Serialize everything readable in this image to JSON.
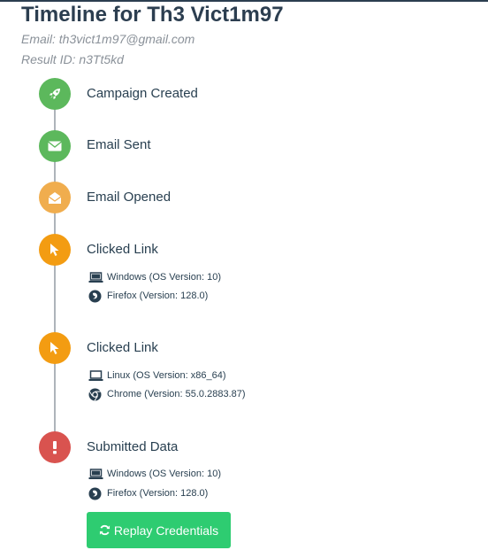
{
  "page": {
    "title": "Timeline for Th3 Vict1m97",
    "email_line": "Email: th3vict1m97@gmail.com",
    "result_line": "Result ID: n3Tt5kd"
  },
  "colors": {
    "created": "#5cb85c",
    "sent": "#5cb85c",
    "opened": "#f0ad4e",
    "clicked": "#f39c12",
    "submitted": "#d9534f",
    "button": "#2ecc71"
  },
  "timeline": [
    {
      "label": "Campaign Created",
      "icon": "rocket-icon"
    },
    {
      "label": "Email Sent",
      "icon": "envelope-icon"
    },
    {
      "label": "Email Opened",
      "icon": "envelope-open-icon"
    },
    {
      "label": "Clicked Link",
      "icon": "mouse-pointer-icon",
      "details": [
        {
          "icon": "laptop-icon",
          "text": "Windows (OS Version: 10)"
        },
        {
          "icon": "firefox-icon",
          "text": "Firefox (Version: 128.0)"
        }
      ]
    },
    {
      "label": "Clicked Link",
      "icon": "mouse-pointer-icon",
      "details": [
        {
          "icon": "laptop-icon",
          "text": "Linux (OS Version: x86_64)"
        },
        {
          "icon": "chrome-icon",
          "text": "Chrome (Version: 55.0.2883.87)"
        }
      ]
    },
    {
      "label": "Submitted Data",
      "icon": "exclamation-icon",
      "details": [
        {
          "icon": "laptop-icon",
          "text": "Windows (OS Version: 10)"
        },
        {
          "icon": "firefox-icon",
          "text": "Firefox (Version: 128.0)"
        }
      ]
    }
  ],
  "replay_button": {
    "label": "Replay Credentials",
    "icon": "refresh-icon"
  }
}
